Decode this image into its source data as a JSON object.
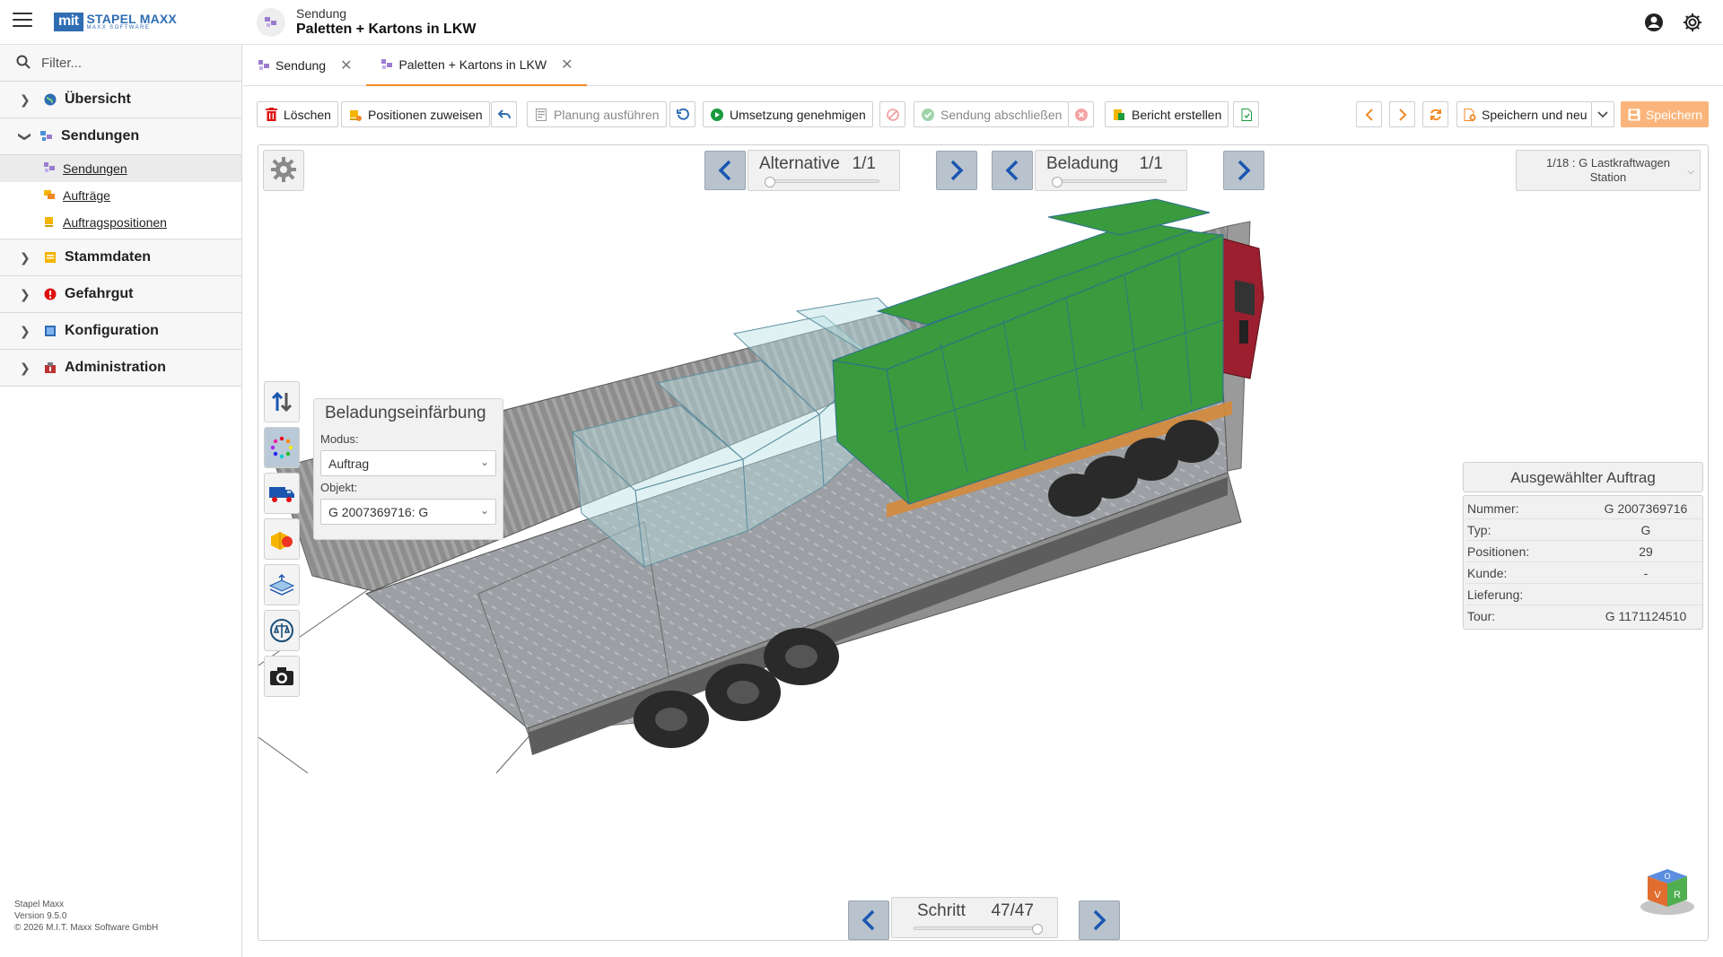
{
  "app": {
    "logo_mark": "mit",
    "logo_name": "STAPEL MAXX",
    "logo_tagline": "MAXX SOFTWARE"
  },
  "header": {
    "subtitle": "Sendung",
    "title": "Paletten + Kartons in LKW"
  },
  "sidebar": {
    "filter_placeholder": "Filter...",
    "groups": [
      {
        "label": "Übersicht",
        "icon": "globe-icon",
        "expanded": false
      },
      {
        "label": "Sendungen",
        "icon": "shipment-icon",
        "expanded": true,
        "items": [
          {
            "label": "Sendungen",
            "icon": "shipment-icon",
            "active": true
          },
          {
            "label": "Aufträge",
            "icon": "orders-icon",
            "active": false
          },
          {
            "label": "Auftragspositionen",
            "icon": "order-positions-icon",
            "active": false
          }
        ]
      },
      {
        "label": "Stammdaten",
        "icon": "master-data-icon",
        "expanded": false
      },
      {
        "label": "Gefahrgut",
        "icon": "hazard-icon",
        "expanded": false
      },
      {
        "label": "Konfiguration",
        "icon": "configuration-icon",
        "expanded": false
      },
      {
        "label": "Administration",
        "icon": "administration-icon",
        "expanded": false
      }
    ],
    "version": {
      "product": "Stapel Maxx",
      "version": "Version 9.5.0",
      "copyright": "© 2026 M.I.T. Maxx Software GmbH"
    }
  },
  "tabs": [
    {
      "label": "Sendung",
      "active": false
    },
    {
      "label": "Paletten + Kartons in LKW",
      "active": true
    }
  ],
  "toolbar": {
    "delete": "Löschen",
    "assign_positions": "Positionen zuweisen",
    "run_planning": "Planung ausführen",
    "approve_implementation": "Umsetzung genehmigen",
    "complete_shipment": "Sendung abschließen",
    "create_report": "Bericht erstellen",
    "save_and_new": "Speichern und neu",
    "save": "Speichern"
  },
  "viewer": {
    "alternative": {
      "label": "Alternative",
      "value": "1/1",
      "position": 0.0
    },
    "loading": {
      "label": "Beladung",
      "value": "1/1",
      "position": 0.0
    },
    "vehicle": {
      "line1": "1/18 : G Lastkraftwagen",
      "line2": "Station"
    },
    "step": {
      "label": "Schritt",
      "value": "47/47",
      "position": 1.0
    },
    "coloring_panel": {
      "title": "Beladungseinfärbung",
      "mode_label": "Modus:",
      "mode_value": "Auftrag",
      "object_label": "Objekt:",
      "object_value": "G 2007369716: G"
    },
    "selected_order": {
      "title": "Ausgewählter Auftrag",
      "rows": [
        {
          "key": "Nummer:",
          "value": "G 2007369716"
        },
        {
          "key": "Typ:",
          "value": "G"
        },
        {
          "key": "Positionen:",
          "value": "29"
        },
        {
          "key": "Kunde:",
          "value": "-"
        },
        {
          "key": "Lieferung:",
          "value": ""
        },
        {
          "key": "Tour:",
          "value": "G 1171124510"
        }
      ]
    },
    "navcube_labels": [
      "O",
      "V",
      "R"
    ]
  },
  "colors": {
    "accent_orange": "#f08a24",
    "save_button": "#fbb57c",
    "nav_button": "#b9c3ce",
    "brand_blue": "#2f6db3",
    "cargo_green": "#3a9a3e"
  }
}
